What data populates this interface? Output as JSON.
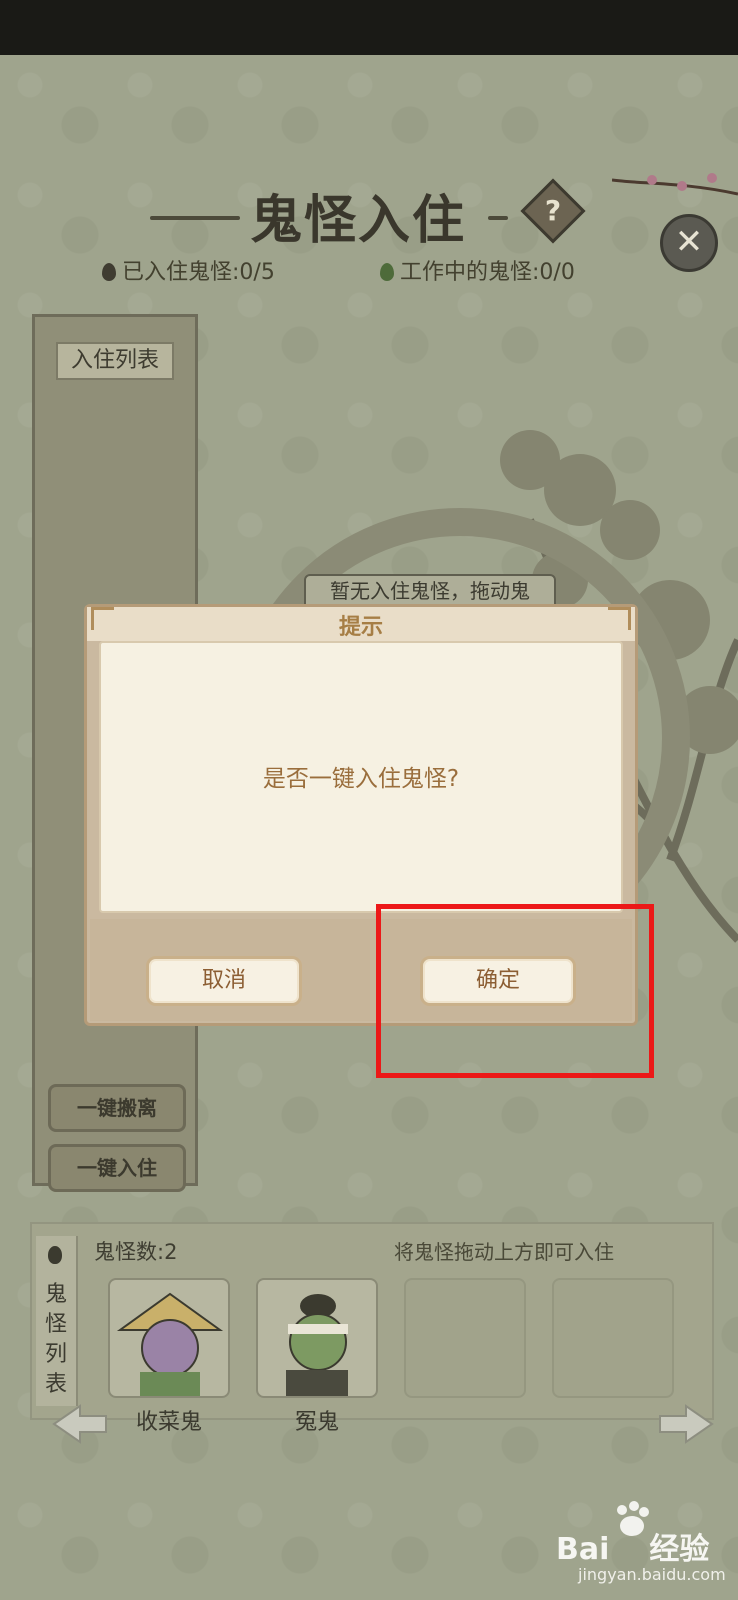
{
  "header": {
    "title": "鬼怪入住",
    "stat_checked_in": "已入住鬼怪:0/5",
    "stat_working": "工作中的鬼怪:0/0",
    "help_symbol": "?",
    "close_symbol": "✕"
  },
  "left_panel": {
    "list_label": "入住列表",
    "evict_all_label": "一键搬离",
    "checkin_all_label": "一键入住"
  },
  "background_label": "暂无入住鬼怪，拖动鬼",
  "dialog": {
    "title": "提示",
    "message": "是否一键入住鬼怪?",
    "cancel_label": "取消",
    "confirm_label": "确定"
  },
  "tray": {
    "tab_label": "鬼怪列表",
    "count": "鬼怪数:2",
    "hint": "将鬼怪拖动上方即可入住",
    "ghosts": [
      {
        "name": "收菜鬼"
      },
      {
        "name": "冤鬼"
      }
    ]
  },
  "watermark": {
    "brand": "Bai",
    "brand2": "经验",
    "url": "jingyan.baidu.com"
  },
  "colors": {
    "highlight": "#ec1818",
    "dialog_text": "#9a6e3c"
  }
}
